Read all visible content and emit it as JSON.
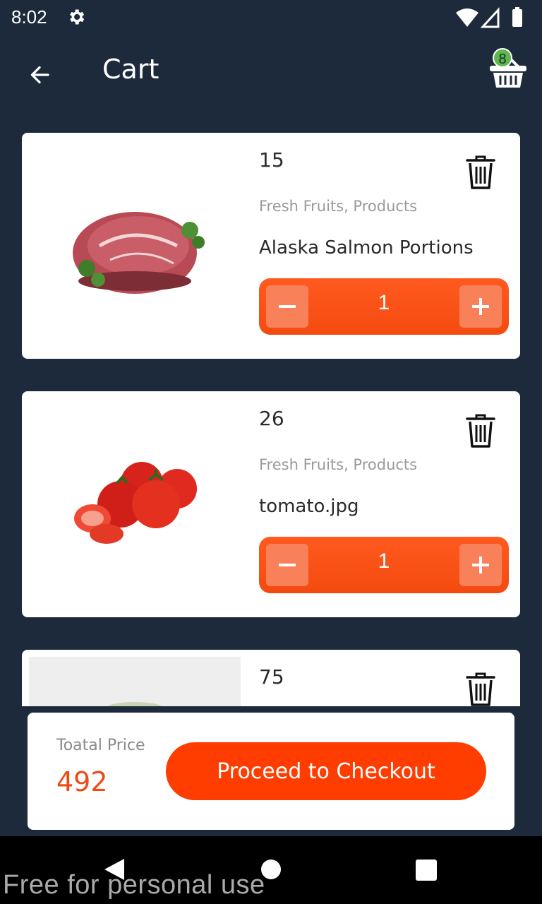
{
  "status_bar": {
    "time": "8:02",
    "icons": [
      "gear-icon",
      "wifi-icon",
      "signal-icon",
      "battery-icon"
    ]
  },
  "app_bar": {
    "title": "Cart",
    "back_icon": "arrow-left-icon",
    "cart_badge_count": "8"
  },
  "cart_items": [
    {
      "price": "15",
      "category": "Fresh Fruits, Products",
      "name": "Alaska Salmon Portions",
      "quantity": "1",
      "image": "raw-meat-steak"
    },
    {
      "price": "26",
      "category": "Fresh Fruits, Products",
      "name": "tomato.jpg",
      "quantity": "1",
      "image": "tomatoes"
    },
    {
      "price": "75",
      "category": "",
      "name": "",
      "quantity": "",
      "image": "partial-product"
    }
  ],
  "footer": {
    "total_label": "Toatal Price",
    "total_value": "492",
    "checkout_label": "Proceed to Checkout"
  },
  "watermark": "Free for personal use",
  "colors": {
    "background": "#1c2a3b",
    "accent": "#ff3d00",
    "stepper": "#f44a10",
    "badge": "#5fb84a"
  }
}
